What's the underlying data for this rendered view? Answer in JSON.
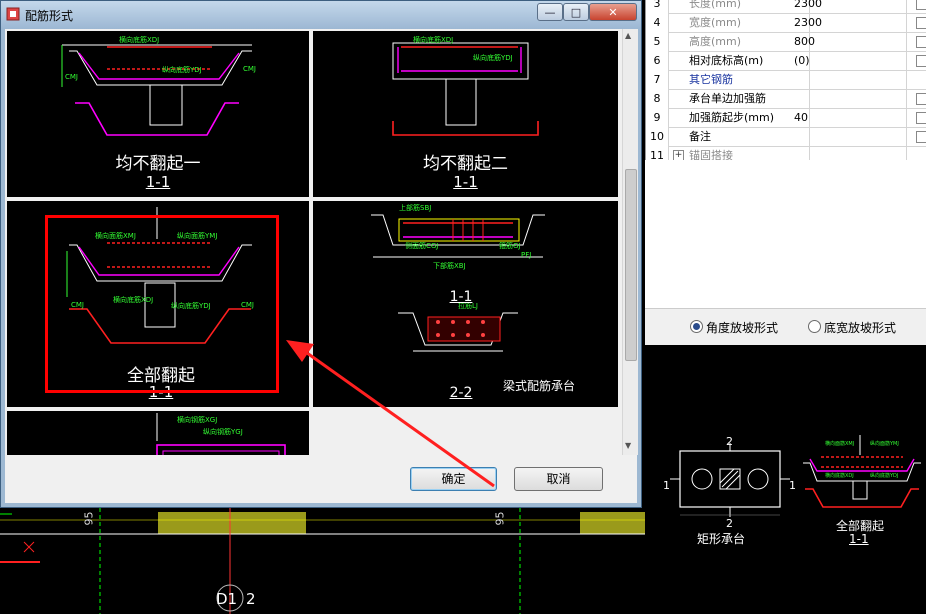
{
  "dialog": {
    "title": "配筋形式",
    "ok_label": "确定",
    "cancel_label": "取消"
  },
  "thumbnails": [
    {
      "caption": "均不翻起一",
      "section": "1-1",
      "labels": [
        "横向底筋XDJ",
        "纵向底筋YDJ",
        "CMJ",
        "CMJ"
      ]
    },
    {
      "caption": "均不翻起二",
      "section": "1-1",
      "labels": [
        "横向底筋XDJ",
        "纵向底筋YDJ"
      ]
    },
    {
      "caption": "全部翻起",
      "section": "1-1",
      "selected": true,
      "labels": [
        "横向面筋XMJ",
        "纵向面筋YMJ",
        "横向底筋XDJ",
        "纵向底筋YDJ",
        "CMJ",
        "CMJ"
      ]
    },
    {
      "caption": "梁式配筋承台",
      "section": "1-1",
      "section2": "2-2",
      "labels": [
        "上部筋SBJ",
        "侧面筋CGJ",
        "下部筋XBJ",
        "拉筋LJ",
        "箍筋GJ",
        "PFJ"
      ]
    },
    {
      "caption": "",
      "labels": [
        "横向钢筋XGJ",
        "纵向钢筋YGJ"
      ]
    }
  ],
  "properties": [
    {
      "num": "3",
      "name": "长度(mm)",
      "value": "2300",
      "gray": true,
      "checkbox": true
    },
    {
      "num": "4",
      "name": "宽度(mm)",
      "value": "2300",
      "gray": true,
      "checkbox": true
    },
    {
      "num": "5",
      "name": "高度(mm)",
      "value": "800",
      "gray": true,
      "checkbox": true
    },
    {
      "num": "6",
      "name": "相对底标高(m)",
      "value": "(0)",
      "gray": false,
      "checkbox": true
    },
    {
      "num": "7",
      "name": "其它钢筋",
      "value": "",
      "gray": false,
      "blue": true,
      "checkbox": false
    },
    {
      "num": "8",
      "name": "承台单边加强筋",
      "value": "",
      "gray": false,
      "checkbox": true
    },
    {
      "num": "9",
      "name": "加强筋起步(mm)",
      "value": "40",
      "gray": false,
      "checkbox": true
    },
    {
      "num": "10",
      "name": "备注",
      "value": "",
      "gray": false,
      "checkbox": true
    },
    {
      "num": "11",
      "name": "锚固搭接",
      "value": "",
      "gray": true,
      "checkbox": false,
      "expander": "+"
    }
  ],
  "slope_options": [
    {
      "label": "角度放坡形式",
      "selected": true
    },
    {
      "label": "底宽放坡形式",
      "selected": false
    }
  ],
  "preview": {
    "left_caption": "矩形承台",
    "right_caption": "全部翻起",
    "right_section": "1-1",
    "dim_top": "2",
    "dim_bottom": "2",
    "dim_left": "1",
    "dim_right": "1"
  },
  "canvas": {
    "axis_label": "D1",
    "axis_label2": "2",
    "dim_left": "95",
    "dim_right": "95"
  },
  "colors": {
    "selection_border": "#ff0000",
    "annotation_arrow": "#ff2020",
    "rebar_magenta": "#ff00ff",
    "rebar_red": "#ff2020",
    "text_green": "#33ff33"
  }
}
